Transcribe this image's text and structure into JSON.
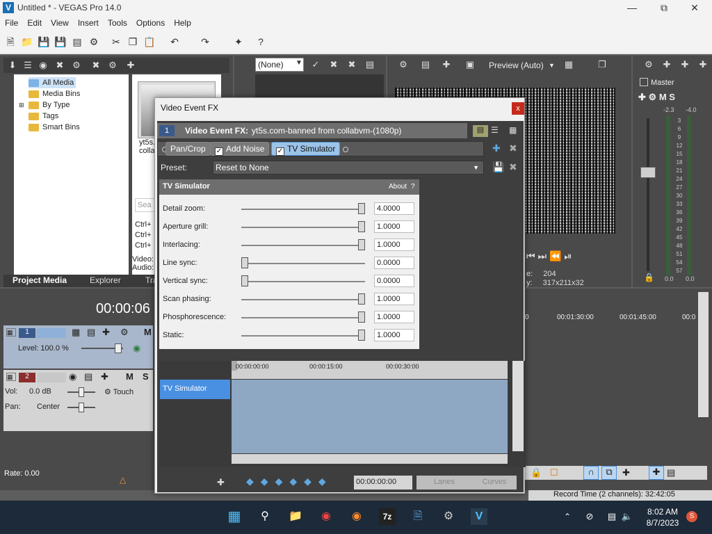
{
  "window": {
    "title": "Untitled * - VEGAS Pro 14.0",
    "app_icon": "V"
  },
  "menu": [
    "File",
    "Edit",
    "View",
    "Insert",
    "Tools",
    "Options",
    "Help"
  ],
  "explorer": {
    "items": [
      "All Media",
      "Media Bins",
      "By Type",
      "Tags",
      "Smart Bins"
    ],
    "thumb_caption": "yt5s.\ncolla",
    "search_placeholder": "Sea",
    "shortcuts": [
      "Ctrl+",
      "Ctrl+",
      "Ctrl+"
    ],
    "info": [
      "Video:",
      "Audio:"
    ],
    "tabs": [
      "Project Media",
      "Explorer",
      "Tra"
    ]
  },
  "fx_toolbar": {
    "preset_select": "(None)"
  },
  "preview": {
    "mode": "Preview (Auto)",
    "frame_label": "e:",
    "frame_value": "204",
    "display_label": "y:",
    "display_value": "317x211x32"
  },
  "master": {
    "label": "Master",
    "left_db": "-2.3",
    "right_db": "-4.0",
    "scale": [
      "3",
      "6",
      "9",
      "12",
      "15",
      "18",
      "21",
      "24",
      "27",
      "30",
      "33",
      "36",
      "39",
      "42",
      "45",
      "48",
      "51",
      "54",
      "57"
    ],
    "bottom_left": "0.0",
    "bottom_right": "0.0"
  },
  "timeline": {
    "timecode": "00:00:06",
    "track1": {
      "number": "1",
      "level": "Level: 100.0 %"
    },
    "track2": {
      "number": "2",
      "vol": "Vol:",
      "vol_value": "0.0 dB",
      "pan": "Pan:",
      "pan_value": "Center",
      "mode": "Touch"
    },
    "ruler": [
      "0",
      "00:01:30:00",
      "00:01:45:00",
      "00:0"
    ],
    "rate": "Rate: 0.00",
    "record_time": "Record Time (2 channels): 32:42:05"
  },
  "dialog": {
    "title": "Video Event FX",
    "close": "x",
    "chain_index": "1",
    "chain_title_label": "Video Event FX:",
    "chain_title_value": "yt5s.com-banned from collabvm-(1080p)",
    "chips": [
      {
        "label": "Pan/Crop",
        "checked": false
      },
      {
        "label": "Add Noise",
        "checked": true
      },
      {
        "label": "TV Simulator",
        "checked": true
      }
    ],
    "preset_label": "Preset:",
    "preset_value": "Reset to None",
    "plugin_title": "TV Simulator",
    "about": "About",
    "help": "?",
    "params": [
      {
        "label": "Detail zoom:",
        "value": "4.0000",
        "position": 1.0
      },
      {
        "label": "Aperture grill:",
        "value": "1.0000",
        "position": 1.0
      },
      {
        "label": "Interlacing:",
        "value": "1.0000",
        "position": 1.0
      },
      {
        "label": "Line sync:",
        "value": "0.0000",
        "position": 0.0
      },
      {
        "label": "Vertical sync:",
        "value": "0.0000",
        "position": 0.0
      },
      {
        "label": "Scan phasing:",
        "value": "1.0000",
        "position": 1.0
      },
      {
        "label": "Phosphorescence:",
        "value": "1.0000",
        "position": 1.0
      },
      {
        "label": "Static:",
        "value": "1.0000",
        "position": 1.0
      }
    ],
    "keyframe_ruler": [
      "00:00:00:00",
      "00:00:15:00",
      "00:00:30:00"
    ],
    "keyframe_track": "TV Simulator",
    "keyframe_time": "00:00:00:00",
    "lanes": "Lanes",
    "curves": "Curves"
  },
  "taskbar": {
    "time": "8:02 AM",
    "date": "8/7/2023",
    "badge": "S",
    "sevenzip": "7z"
  },
  "colors": {
    "accent": "#4a90e2",
    "panel": "#4a4a4a",
    "taskbar": "#1c2a39"
  }
}
